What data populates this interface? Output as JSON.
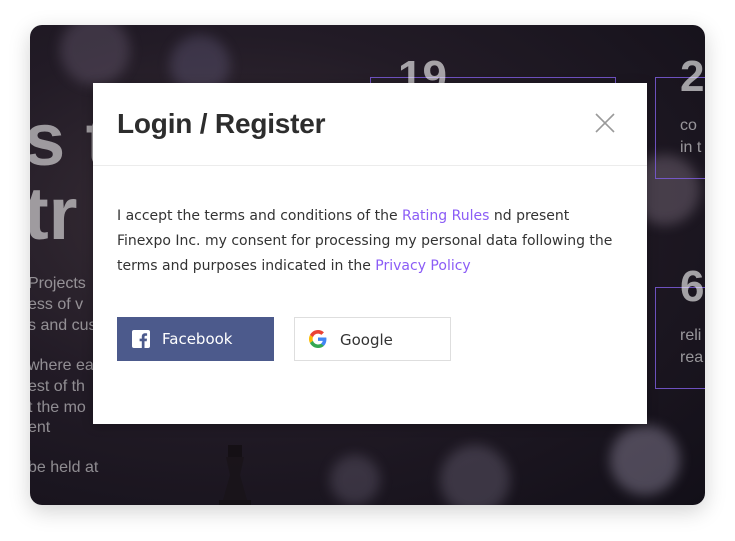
{
  "background": {
    "big_text_line1": "s t",
    "big_text_line2": "tr",
    "para1": [
      "Projects",
      "ess of v",
      "s and cus"
    ],
    "para2": [
      "where ea",
      "est of th",
      "t the mo",
      "ent"
    ],
    "para3": "be held at",
    "stat1": {
      "number": "19"
    },
    "stat2": {
      "number": "2",
      "lines": [
        "co",
        "in t"
      ]
    },
    "stat3": {
      "number": "6",
      "lines": [
        "reli",
        "rea"
      ]
    }
  },
  "modal": {
    "title": "Login / Register",
    "body": {
      "text_before": "I accept the terms and conditions of the ",
      "rating_rules_link": "Rating Rules",
      "text_middle": " nd present Finexpo Inc. my consent for processing my personal data following the terms and purposes indicated in the ",
      "privacy_policy_link": "Privacy Policy"
    },
    "facebook_button": {
      "label": "Facebook",
      "icon": "facebook-icon",
      "color": "#4c5a8c"
    },
    "google_button": {
      "label": "Google",
      "icon": "google-icon"
    },
    "close_icon": "close-icon",
    "link_color": "#8b5cf6"
  }
}
